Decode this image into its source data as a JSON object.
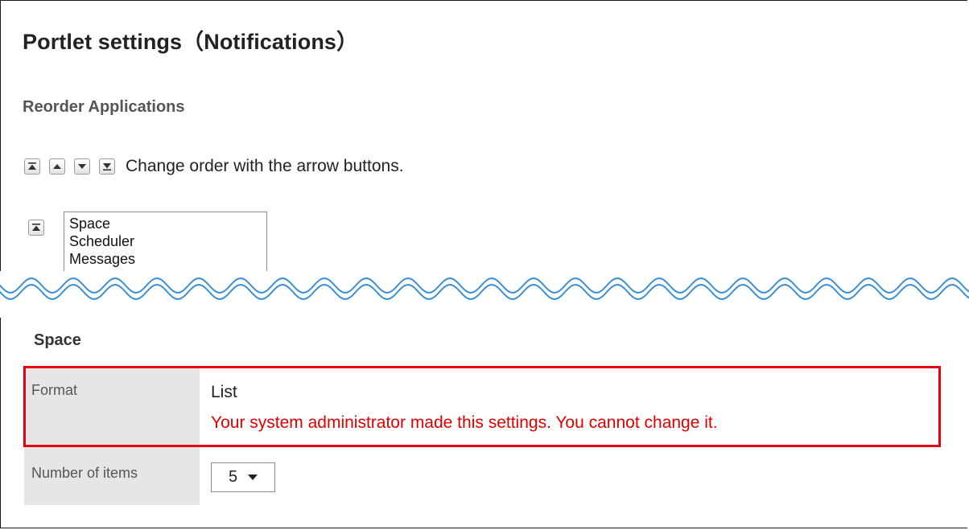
{
  "header": {
    "title": "Portlet settings（Notifications）"
  },
  "reorder": {
    "section_title": "Reorder Applications",
    "buttons": [
      {
        "icon": "move-to-top-icon"
      },
      {
        "icon": "move-up-icon"
      },
      {
        "icon": "move-down-icon"
      },
      {
        "icon": "move-to-bottom-icon"
      }
    ],
    "hint": "Change order with the arrow buttons.",
    "side_button_icon": "move-to-top-icon",
    "applications": [
      "Space",
      "Scheduler",
      "Messages"
    ]
  },
  "space": {
    "title": "Space",
    "format": {
      "label": "Format",
      "value": "List",
      "note": "Your system administrator made this settings. You cannot change it."
    },
    "number_of_items": {
      "label": "Number of items",
      "selected": "5"
    }
  },
  "colors": {
    "highlight_border": "#e60012",
    "note_text": "#e00000",
    "label_background": "#e6e6e6",
    "wave_stroke": "#3a8fd6"
  }
}
